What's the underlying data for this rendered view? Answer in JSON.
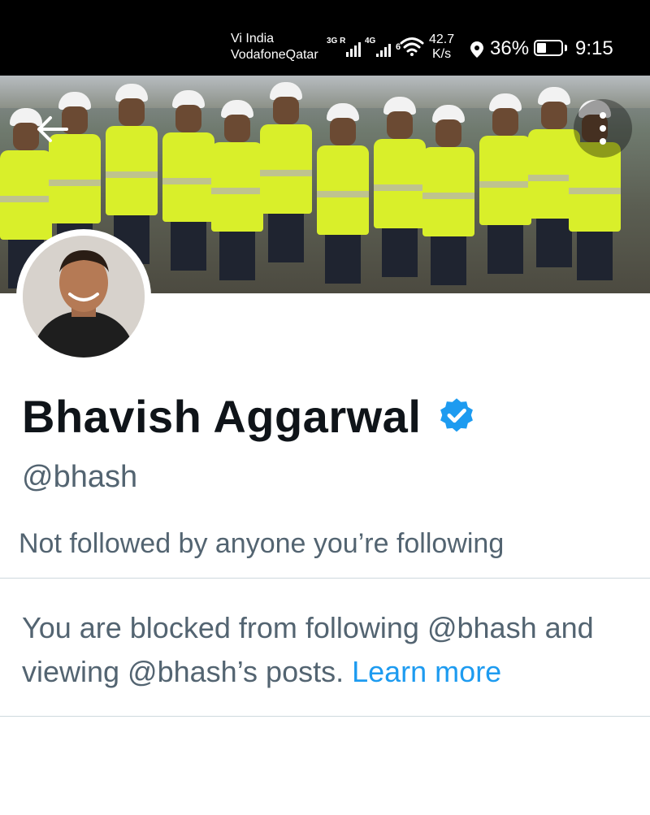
{
  "status_bar": {
    "carrier_1": "Vi India",
    "carrier_2": "VodafoneQatar",
    "net_1": "3G",
    "net_1_sup": "R",
    "net_2": "4G",
    "net_3": "6",
    "speed_value": "42.7",
    "speed_unit": "K/s",
    "battery_percent": "36%",
    "battery_level": 0.36,
    "time": "9:15",
    "icons": [
      "signal-icon",
      "wifi-icon",
      "location-icon",
      "battery-icon"
    ]
  },
  "header": {
    "back_icon": "arrow-left-icon",
    "more_icon": "more-vertical-icon"
  },
  "profile": {
    "name": "Bhavish Aggarwal",
    "verified_icon": "verified-badge-icon",
    "verified_color": "#1d9bf0",
    "handle": "@bhash",
    "followed_by": "Not followed by anyone you’re following",
    "blocked_text": "You are blocked from following @bhash and viewing @bhash’s posts.",
    "learn_more": "Learn more"
  },
  "colors": {
    "text_primary": "#0f1419",
    "text_secondary": "#536471",
    "link": "#1d9bf0",
    "divider": "#cfd9de"
  }
}
